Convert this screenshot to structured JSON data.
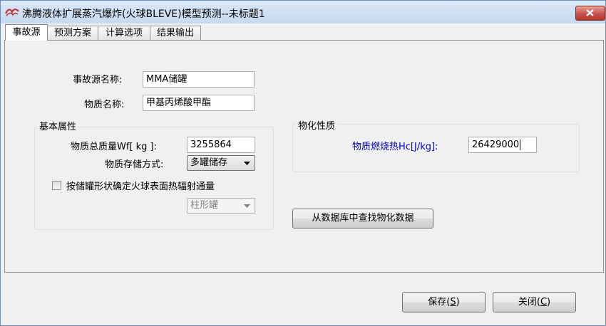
{
  "window": {
    "title": "沸腾液体扩展蒸汽爆炸(火球BLEVE)模型预测--未标题1",
    "icon": "app-logo-icon",
    "close_icon": "close-icon"
  },
  "tabs": [
    {
      "label": "事故源",
      "active": true
    },
    {
      "label": "预测方案",
      "active": false
    },
    {
      "label": "计算选项",
      "active": false
    },
    {
      "label": "结果输出",
      "active": false
    }
  ],
  "source": {
    "name_label": "事故源名称:",
    "name_value": "MMA储罐",
    "substance_label": "物质名称:",
    "substance_value": "甲基丙烯酸甲酯"
  },
  "basic": {
    "group_title": "基本属性",
    "mass_label": "物质总质量Wf[ kg ]:",
    "mass_value": "3255864",
    "storage_label": "物质存储方式:",
    "storage_value": "多罐储存",
    "checkbox_label": "按储罐形状确定火球表面热辐射通量",
    "checkbox_checked": false,
    "shape_value": "柱形罐"
  },
  "physchem": {
    "group_title": "物化性质",
    "heat_label": "物质燃烧热Hc[J/kg]:",
    "heat_value": "26429000",
    "db_button": "从数据库中查找物化数据"
  },
  "footer": {
    "save_label": "保存",
    "save_key": "S",
    "close_label": "关闭",
    "close_key": "C"
  },
  "colors": {
    "label_blue": "#0000c0",
    "close_red": "#c75050"
  }
}
